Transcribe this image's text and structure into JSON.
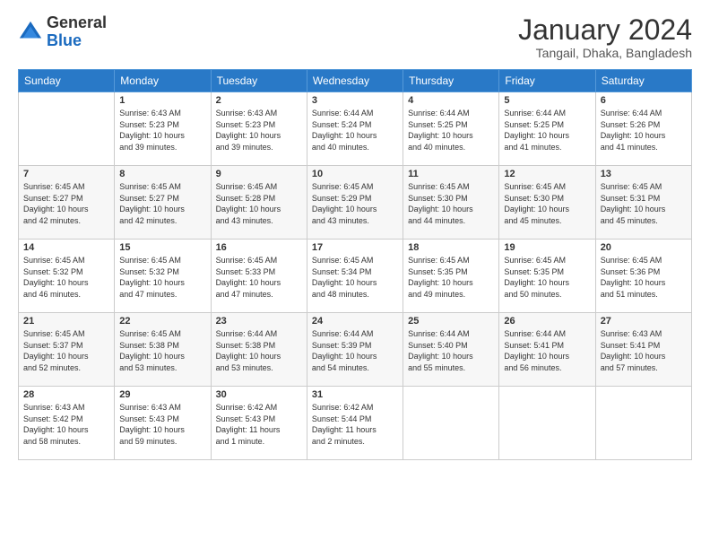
{
  "logo": {
    "general": "General",
    "blue": "Blue"
  },
  "header": {
    "month": "January 2024",
    "location": "Tangail, Dhaka, Bangladesh"
  },
  "weekdays": [
    "Sunday",
    "Monday",
    "Tuesday",
    "Wednesday",
    "Thursday",
    "Friday",
    "Saturday"
  ],
  "weeks": [
    [
      {
        "day": "",
        "info": ""
      },
      {
        "day": "1",
        "info": "Sunrise: 6:43 AM\nSunset: 5:23 PM\nDaylight: 10 hours\nand 39 minutes."
      },
      {
        "day": "2",
        "info": "Sunrise: 6:43 AM\nSunset: 5:23 PM\nDaylight: 10 hours\nand 39 minutes."
      },
      {
        "day": "3",
        "info": "Sunrise: 6:44 AM\nSunset: 5:24 PM\nDaylight: 10 hours\nand 40 minutes."
      },
      {
        "day": "4",
        "info": "Sunrise: 6:44 AM\nSunset: 5:25 PM\nDaylight: 10 hours\nand 40 minutes."
      },
      {
        "day": "5",
        "info": "Sunrise: 6:44 AM\nSunset: 5:25 PM\nDaylight: 10 hours\nand 41 minutes."
      },
      {
        "day": "6",
        "info": "Sunrise: 6:44 AM\nSunset: 5:26 PM\nDaylight: 10 hours\nand 41 minutes."
      }
    ],
    [
      {
        "day": "7",
        "info": "Sunrise: 6:45 AM\nSunset: 5:27 PM\nDaylight: 10 hours\nand 42 minutes."
      },
      {
        "day": "8",
        "info": "Sunrise: 6:45 AM\nSunset: 5:27 PM\nDaylight: 10 hours\nand 42 minutes."
      },
      {
        "day": "9",
        "info": "Sunrise: 6:45 AM\nSunset: 5:28 PM\nDaylight: 10 hours\nand 43 minutes."
      },
      {
        "day": "10",
        "info": "Sunrise: 6:45 AM\nSunset: 5:29 PM\nDaylight: 10 hours\nand 43 minutes."
      },
      {
        "day": "11",
        "info": "Sunrise: 6:45 AM\nSunset: 5:30 PM\nDaylight: 10 hours\nand 44 minutes."
      },
      {
        "day": "12",
        "info": "Sunrise: 6:45 AM\nSunset: 5:30 PM\nDaylight: 10 hours\nand 45 minutes."
      },
      {
        "day": "13",
        "info": "Sunrise: 6:45 AM\nSunset: 5:31 PM\nDaylight: 10 hours\nand 45 minutes."
      }
    ],
    [
      {
        "day": "14",
        "info": "Sunrise: 6:45 AM\nSunset: 5:32 PM\nDaylight: 10 hours\nand 46 minutes."
      },
      {
        "day": "15",
        "info": "Sunrise: 6:45 AM\nSunset: 5:32 PM\nDaylight: 10 hours\nand 47 minutes."
      },
      {
        "day": "16",
        "info": "Sunrise: 6:45 AM\nSunset: 5:33 PM\nDaylight: 10 hours\nand 47 minutes."
      },
      {
        "day": "17",
        "info": "Sunrise: 6:45 AM\nSunset: 5:34 PM\nDaylight: 10 hours\nand 48 minutes."
      },
      {
        "day": "18",
        "info": "Sunrise: 6:45 AM\nSunset: 5:35 PM\nDaylight: 10 hours\nand 49 minutes."
      },
      {
        "day": "19",
        "info": "Sunrise: 6:45 AM\nSunset: 5:35 PM\nDaylight: 10 hours\nand 50 minutes."
      },
      {
        "day": "20",
        "info": "Sunrise: 6:45 AM\nSunset: 5:36 PM\nDaylight: 10 hours\nand 51 minutes."
      }
    ],
    [
      {
        "day": "21",
        "info": "Sunrise: 6:45 AM\nSunset: 5:37 PM\nDaylight: 10 hours\nand 52 minutes."
      },
      {
        "day": "22",
        "info": "Sunrise: 6:45 AM\nSunset: 5:38 PM\nDaylight: 10 hours\nand 53 minutes."
      },
      {
        "day": "23",
        "info": "Sunrise: 6:44 AM\nSunset: 5:38 PM\nDaylight: 10 hours\nand 53 minutes."
      },
      {
        "day": "24",
        "info": "Sunrise: 6:44 AM\nSunset: 5:39 PM\nDaylight: 10 hours\nand 54 minutes."
      },
      {
        "day": "25",
        "info": "Sunrise: 6:44 AM\nSunset: 5:40 PM\nDaylight: 10 hours\nand 55 minutes."
      },
      {
        "day": "26",
        "info": "Sunrise: 6:44 AM\nSunset: 5:41 PM\nDaylight: 10 hours\nand 56 minutes."
      },
      {
        "day": "27",
        "info": "Sunrise: 6:43 AM\nSunset: 5:41 PM\nDaylight: 10 hours\nand 57 minutes."
      }
    ],
    [
      {
        "day": "28",
        "info": "Sunrise: 6:43 AM\nSunset: 5:42 PM\nDaylight: 10 hours\nand 58 minutes."
      },
      {
        "day": "29",
        "info": "Sunrise: 6:43 AM\nSunset: 5:43 PM\nDaylight: 10 hours\nand 59 minutes."
      },
      {
        "day": "30",
        "info": "Sunrise: 6:42 AM\nSunset: 5:43 PM\nDaylight: 11 hours\nand 1 minute."
      },
      {
        "day": "31",
        "info": "Sunrise: 6:42 AM\nSunset: 5:44 PM\nDaylight: 11 hours\nand 2 minutes."
      },
      {
        "day": "",
        "info": ""
      },
      {
        "day": "",
        "info": ""
      },
      {
        "day": "",
        "info": ""
      }
    ]
  ]
}
